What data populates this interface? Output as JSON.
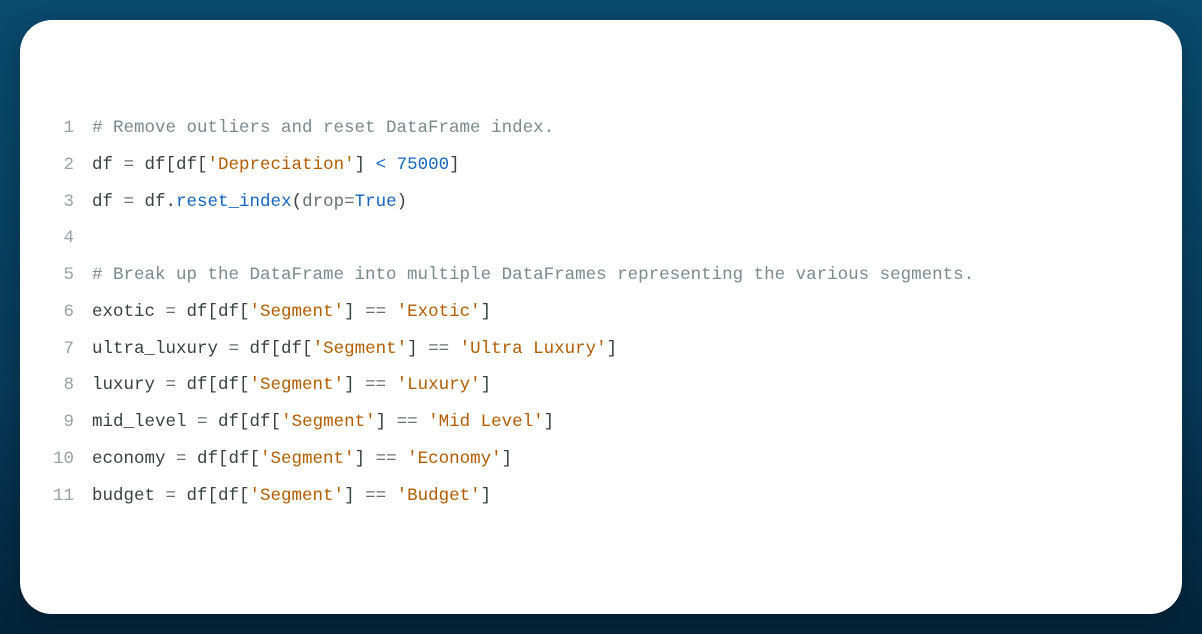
{
  "lines": [
    {
      "num": "1",
      "tokens": [
        {
          "t": "# Remove outliers and reset DataFrame index.",
          "c": "tok-comment"
        }
      ]
    },
    {
      "num": "2",
      "tokens": [
        {
          "t": "df ",
          "c": "tok-default"
        },
        {
          "t": "=",
          "c": "tok-op"
        },
        {
          "t": " df[df[",
          "c": "tok-default"
        },
        {
          "t": "'Depreciation'",
          "c": "tok-str"
        },
        {
          "t": "] ",
          "c": "tok-default"
        },
        {
          "t": "<",
          "c": "tok-lt"
        },
        {
          "t": " ",
          "c": "tok-default"
        },
        {
          "t": "75000",
          "c": "tok-num"
        },
        {
          "t": "]",
          "c": "tok-default"
        }
      ]
    },
    {
      "num": "3",
      "tokens": [
        {
          "t": "df ",
          "c": "tok-default"
        },
        {
          "t": "=",
          "c": "tok-op"
        },
        {
          "t": " df.",
          "c": "tok-default"
        },
        {
          "t": "reset_index",
          "c": "tok-call"
        },
        {
          "t": "(",
          "c": "tok-default"
        },
        {
          "t": "drop",
          "c": "tok-kwarg"
        },
        {
          "t": "=",
          "c": "tok-op"
        },
        {
          "t": "True",
          "c": "tok-const"
        },
        {
          "t": ")",
          "c": "tok-default"
        }
      ]
    },
    {
      "num": "4",
      "tokens": [
        {
          "t": " ",
          "c": "tok-default"
        }
      ]
    },
    {
      "num": "5",
      "tokens": [
        {
          "t": "# Break up the DataFrame into multiple DataFrames representing the various segments.",
          "c": "tok-comment"
        }
      ]
    },
    {
      "num": "6",
      "tokens": [
        {
          "t": "exotic ",
          "c": "tok-default"
        },
        {
          "t": "=",
          "c": "tok-op"
        },
        {
          "t": " df[df[",
          "c": "tok-default"
        },
        {
          "t": "'Segment'",
          "c": "tok-str"
        },
        {
          "t": "] ",
          "c": "tok-default"
        },
        {
          "t": "==",
          "c": "tok-op"
        },
        {
          "t": " ",
          "c": "tok-default"
        },
        {
          "t": "'Exotic'",
          "c": "tok-str"
        },
        {
          "t": "]",
          "c": "tok-default"
        }
      ]
    },
    {
      "num": "7",
      "tokens": [
        {
          "t": "ultra_luxury ",
          "c": "tok-default"
        },
        {
          "t": "=",
          "c": "tok-op"
        },
        {
          "t": " df[df[",
          "c": "tok-default"
        },
        {
          "t": "'Segment'",
          "c": "tok-str"
        },
        {
          "t": "] ",
          "c": "tok-default"
        },
        {
          "t": "==",
          "c": "tok-op"
        },
        {
          "t": " ",
          "c": "tok-default"
        },
        {
          "t": "'Ultra Luxury'",
          "c": "tok-str"
        },
        {
          "t": "]",
          "c": "tok-default"
        }
      ]
    },
    {
      "num": "8",
      "tokens": [
        {
          "t": "luxury ",
          "c": "tok-default"
        },
        {
          "t": "=",
          "c": "tok-op"
        },
        {
          "t": " df[df[",
          "c": "tok-default"
        },
        {
          "t": "'Segment'",
          "c": "tok-str"
        },
        {
          "t": "] ",
          "c": "tok-default"
        },
        {
          "t": "==",
          "c": "tok-op"
        },
        {
          "t": " ",
          "c": "tok-default"
        },
        {
          "t": "'Luxury'",
          "c": "tok-str"
        },
        {
          "t": "]",
          "c": "tok-default"
        }
      ]
    },
    {
      "num": "9",
      "tokens": [
        {
          "t": "mid_level ",
          "c": "tok-default"
        },
        {
          "t": "=",
          "c": "tok-op"
        },
        {
          "t": " df[df[",
          "c": "tok-default"
        },
        {
          "t": "'Segment'",
          "c": "tok-str"
        },
        {
          "t": "] ",
          "c": "tok-default"
        },
        {
          "t": "==",
          "c": "tok-op"
        },
        {
          "t": " ",
          "c": "tok-default"
        },
        {
          "t": "'Mid Level'",
          "c": "tok-str"
        },
        {
          "t": "]",
          "c": "tok-default"
        }
      ]
    },
    {
      "num": "10",
      "tokens": [
        {
          "t": "economy ",
          "c": "tok-default"
        },
        {
          "t": "=",
          "c": "tok-op"
        },
        {
          "t": " df[df[",
          "c": "tok-default"
        },
        {
          "t": "'Segment'",
          "c": "tok-str"
        },
        {
          "t": "] ",
          "c": "tok-default"
        },
        {
          "t": "==",
          "c": "tok-op"
        },
        {
          "t": " ",
          "c": "tok-default"
        },
        {
          "t": "'Economy'",
          "c": "tok-str"
        },
        {
          "t": "]",
          "c": "tok-default"
        }
      ]
    },
    {
      "num": "11",
      "tokens": [
        {
          "t": "budget ",
          "c": "tok-default"
        },
        {
          "t": "=",
          "c": "tok-op"
        },
        {
          "t": " df[df[",
          "c": "tok-default"
        },
        {
          "t": "'Segment'",
          "c": "tok-str"
        },
        {
          "t": "] ",
          "c": "tok-default"
        },
        {
          "t": "==",
          "c": "tok-op"
        },
        {
          "t": " ",
          "c": "tok-default"
        },
        {
          "t": "'Budget'",
          "c": "tok-str"
        },
        {
          "t": "]",
          "c": "tok-default"
        }
      ]
    }
  ]
}
